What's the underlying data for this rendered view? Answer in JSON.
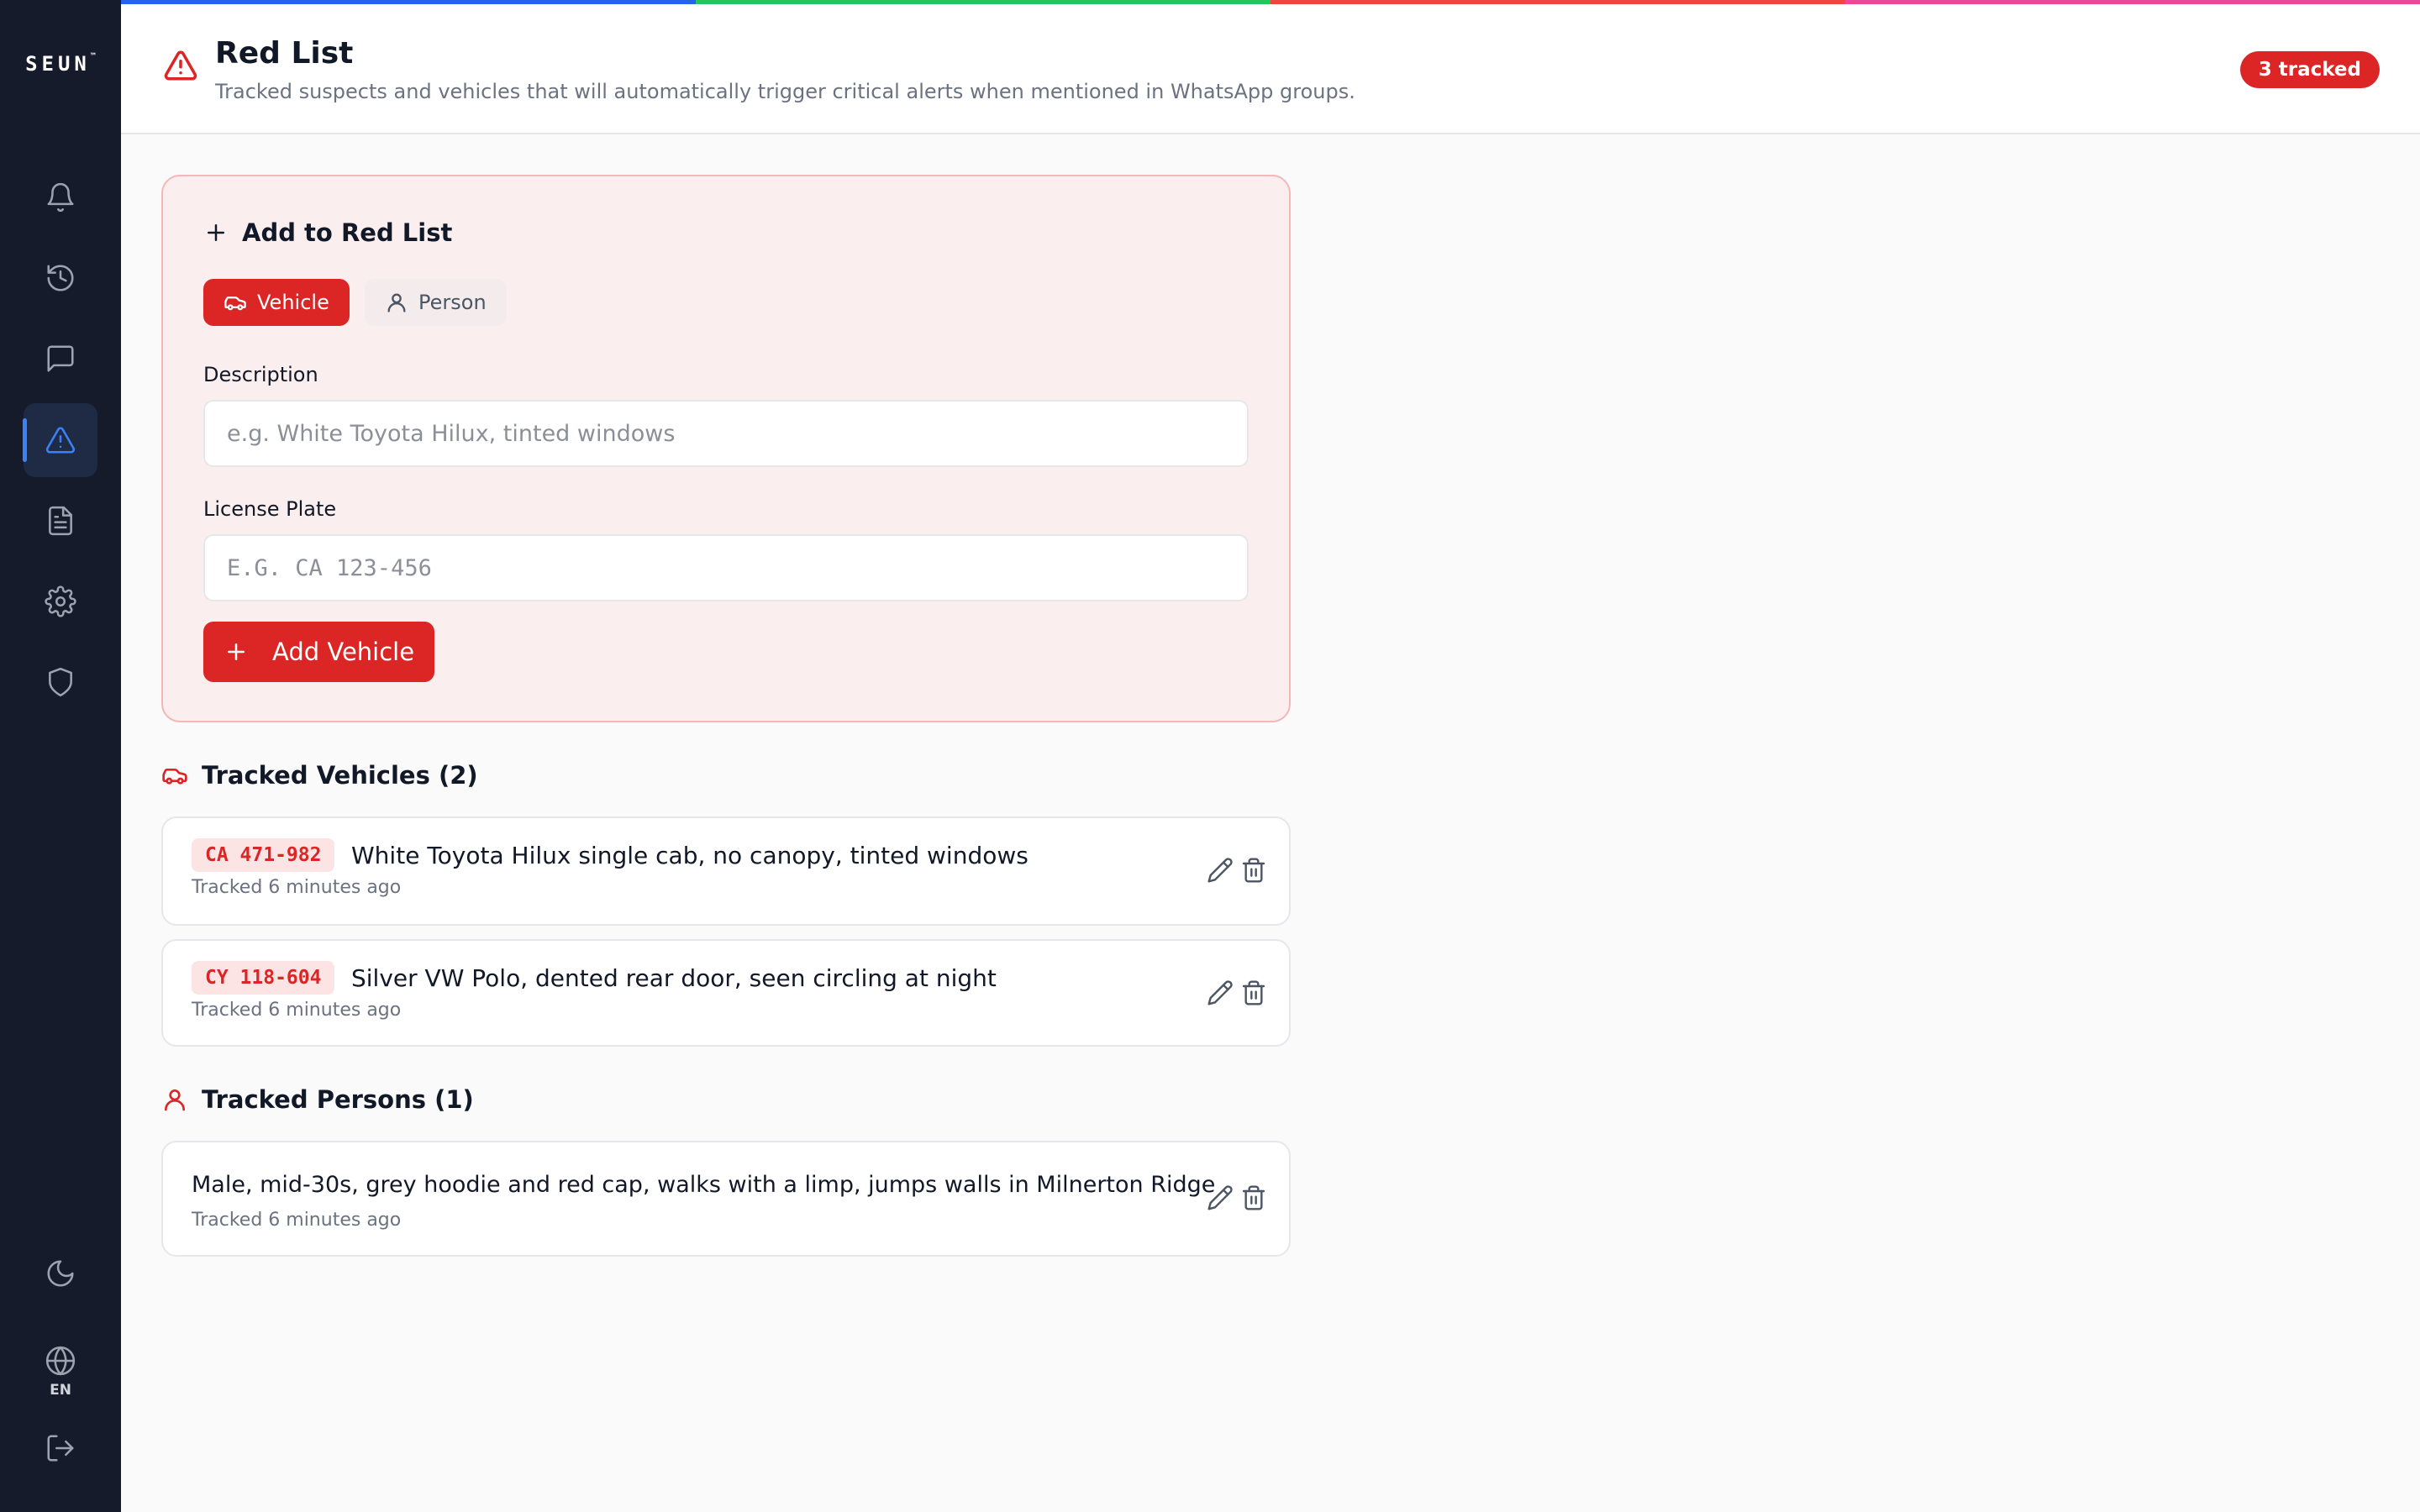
{
  "sidebar": {
    "logo": "SEUN",
    "logo_mark": "™",
    "nav_items": [
      {
        "name": "alerts",
        "icon": "bell-icon"
      },
      {
        "name": "history",
        "icon": "history-icon"
      },
      {
        "name": "messages",
        "icon": "message-icon"
      },
      {
        "name": "red-list",
        "icon": "alert-triangle-icon",
        "active": true
      },
      {
        "name": "reports",
        "icon": "document-icon"
      },
      {
        "name": "settings",
        "icon": "gear-icon"
      },
      {
        "name": "security",
        "icon": "shield-icon"
      }
    ],
    "bottom_items": [
      {
        "name": "theme-toggle",
        "icon": "moon-icon"
      },
      {
        "name": "language",
        "icon": "globe-icon"
      },
      {
        "name": "logout",
        "icon": "logout-icon"
      }
    ],
    "language_label": "EN"
  },
  "strip_colors": [
    "#2563eb",
    "#22c55e",
    "#ef4444",
    "#ec4899"
  ],
  "header": {
    "title": "Red List",
    "subtitle": "Tracked suspects and vehicles that will automatically trigger critical alerts when mentioned in WhatsApp groups.",
    "badge": "3 tracked"
  },
  "form": {
    "title": "Add to Red List",
    "type_vehicle": "Vehicle",
    "type_person": "Person",
    "description_label": "Description",
    "description_placeholder": "e.g. White Toyota Hilux, tinted windows",
    "plate_label": "License Plate",
    "plate_placeholder": "E.G. CA 123-456",
    "submit_label": "Add Vehicle"
  },
  "vehicles": {
    "title": "Tracked Vehicles (2)",
    "items": [
      {
        "plate": "CA 471-982",
        "description": "White Toyota Hilux single cab, no canopy, tinted windows",
        "meta": "Tracked 6 minutes ago"
      },
      {
        "plate": "CY 118-604",
        "description": "Silver VW Polo, dented rear door, seen circling at night",
        "meta": "Tracked 6 minutes ago"
      }
    ]
  },
  "persons": {
    "title": "Tracked Persons (1)",
    "items": [
      {
        "description": "Male, mid-30s, grey hoodie and red cap, walks with a limp, jumps walls in Milnerton Ridge",
        "meta": "Tracked 6 minutes ago"
      }
    ]
  },
  "colors": {
    "sidebar_bg": "#161b2c",
    "accent_red": "#dc2626",
    "active_blue": "#3b82f6"
  }
}
